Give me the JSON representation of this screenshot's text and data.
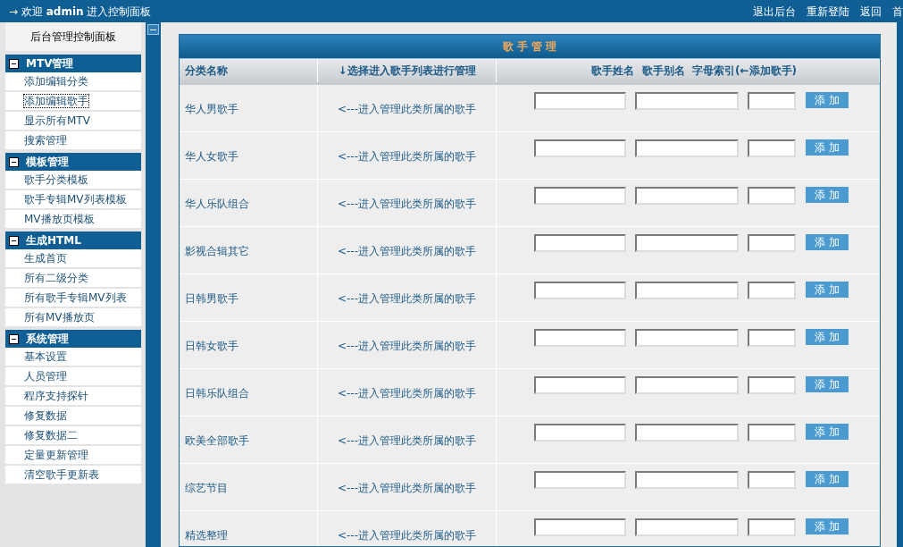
{
  "top_bar": {
    "welcome": "→ 欢迎 **admin** 进入控制面板",
    "links": [
      "退出后台",
      "重新登陆",
      "返回",
      "首"
    ]
  },
  "sidebar": {
    "title": "后台管理控制面板",
    "groups": [
      {
        "title": "MTV管理",
        "items": [
          {
            "label": "添加编辑分类",
            "selected": false
          },
          {
            "label": "添加编辑歌手",
            "selected": true
          },
          {
            "label": "显示所有MTV",
            "selected": false
          },
          {
            "label": "搜索管理",
            "selected": false
          }
        ]
      },
      {
        "title": "模板管理",
        "items": [
          {
            "label": "歌手分类模板",
            "selected": false
          },
          {
            "label": "歌手专辑MV列表模板",
            "selected": false
          },
          {
            "label": "MV播放页模板",
            "selected": false
          }
        ]
      },
      {
        "title": "生成HTML",
        "items": [
          {
            "label": "生成首页",
            "selected": false
          },
          {
            "label": "所有二级分类",
            "selected": false
          },
          {
            "label": "所有歌手专辑MV列表",
            "selected": false
          },
          {
            "label": "所有MV播放页",
            "selected": false
          }
        ]
      },
      {
        "title": "系统管理",
        "items": [
          {
            "label": "基本设置",
            "selected": false
          },
          {
            "label": "人员管理",
            "selected": false
          },
          {
            "label": "程序支持探针",
            "selected": false
          },
          {
            "label": "修复数据",
            "selected": false
          },
          {
            "label": "修复数据二",
            "selected": false
          },
          {
            "label": "定量更新管理",
            "selected": false
          },
          {
            "label": "清空歌手更新表",
            "selected": false
          }
        ]
      }
    ]
  },
  "panel": {
    "title": "歌 手 管 理",
    "columns": [
      "分类名称",
      "↓选择进入歌手列表进行管理",
      "歌手姓名  歌手别名  字母索引(←添加歌手)"
    ],
    "rows": [
      {
        "category": "华人男歌手",
        "link": "<---进入管理此类所属的歌手",
        "button": "添 加"
      },
      {
        "category": "华人女歌手",
        "link": "<---进入管理此类所属的歌手",
        "button": "添 加"
      },
      {
        "category": "华人乐队组合",
        "link": "<---进入管理此类所属的歌手",
        "button": "添 加"
      },
      {
        "category": "影视合辑其它",
        "link": "<---进入管理此类所属的歌手",
        "button": "添 加"
      },
      {
        "category": "日韩男歌手",
        "link": "<---进入管理此类所属的歌手",
        "button": "添 加"
      },
      {
        "category": "日韩女歌手",
        "link": "<---进入管理此类所属的歌手",
        "button": "添 加"
      },
      {
        "category": "日韩乐队组合",
        "link": "<---进入管理此类所属的歌手",
        "button": "添 加"
      },
      {
        "category": "欧美全部歌手",
        "link": "<---进入管理此类所属的歌手",
        "button": "添 加"
      },
      {
        "category": "综艺节目",
        "link": "<---进入管理此类所属的歌手",
        "button": "添 加"
      },
      {
        "category": "精选整理",
        "link": "<---进入管理此类所属的歌手",
        "button": "添 加"
      }
    ]
  }
}
